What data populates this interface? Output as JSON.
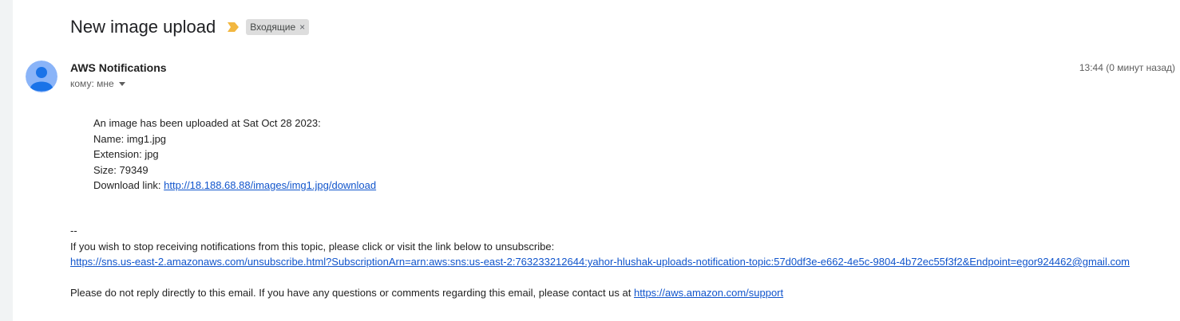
{
  "subject": "New image upload",
  "label": {
    "name": "Входящие",
    "remove": "×"
  },
  "sender": {
    "name": "AWS Notifications",
    "recipient": "кому: мне"
  },
  "time": "13:44 (0 минут назад)",
  "body": {
    "line1": "An image has been uploaded at Sat Oct 28 2023:",
    "name": "Name: img1.jpg",
    "extension": "Extension: jpg",
    "size": "Size: 79349",
    "download_prefix": "Download link: ",
    "download_url": "http://18.188.68.88/images/img1.jpg/download"
  },
  "footer": {
    "separator": "--",
    "unsubscribe_text": "If you wish to stop receiving notifications from this topic, please click or visit the link below to unsubscribe:",
    "unsubscribe_url": "https://sns.us-east-2.amazonaws.com/unsubscribe.html?SubscriptionArn=arn:aws:sns:us-east-2:763233212644:yahor-hlushak-uploads-notification-topic:57d0df3e-e662-4e5c-9804-4b72ec55f3f2&Endpoint=egor924462@gmail.com",
    "support_prefix": "Please do not reply directly to this email. If you have any questions or comments regarding this email, please contact us at ",
    "support_url": "https://aws.amazon.com/support"
  },
  "colors": {
    "link": "#1155cc",
    "importance": "#f2b740",
    "avatar_bg": "#8ab4f8",
    "avatar_fg": "#1a73e8"
  }
}
